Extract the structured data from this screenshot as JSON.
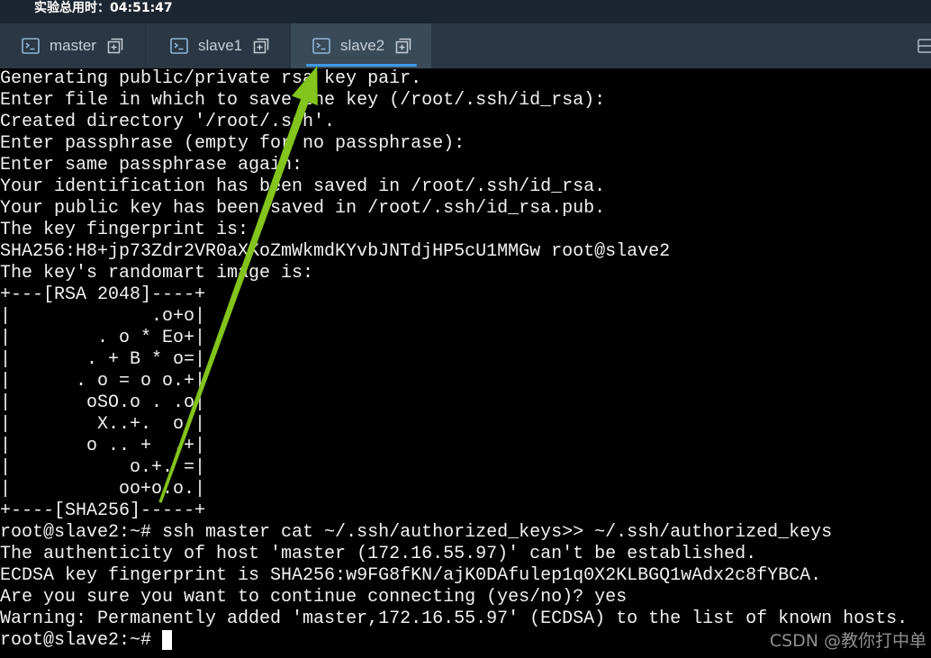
{
  "topbar": {
    "timer": "实验总用时：04:51:47"
  },
  "tabs": [
    {
      "label": "master",
      "icon": "terminal-icon",
      "action_icon": "new-window-icon",
      "active": false
    },
    {
      "label": "slave1",
      "icon": "terminal-icon",
      "action_icon": "new-window-icon",
      "active": false
    },
    {
      "label": "slave2",
      "icon": "terminal-icon",
      "action_icon": "new-window-icon",
      "active": true
    }
  ],
  "tabbar_right_icon": "layout-icon",
  "terminal": {
    "lines": [
      "Generating public/private rsa key pair.",
      "Enter file in which to save the key (/root/.ssh/id_rsa):",
      "Created directory '/root/.ssh'.",
      "Enter passphrase (empty for no passphrase):",
      "Enter same passphrase again:",
      "Your identification has been saved in /root/.ssh/id_rsa.",
      "Your public key has been saved in /root/.ssh/id_rsa.pub.",
      "The key fingerprint is:",
      "SHA256:H8+jp73Zdr2VR0aXKoZmWkmdKYvbJNTdjHP5cU1MMGw root@slave2",
      "The key's randomart image is:",
      "+---[RSA 2048]----+",
      "|             .o+o|",
      "|        . o * Eo+|",
      "|       . + B * o=|",
      "|      . o = o o.+|",
      "|       oSO.o . .o|",
      "|        X..+.  o |",
      "|       o .. +  .+|",
      "|           o.+. =|",
      "|          oo+o.o.|",
      "+----[SHA256]-----+",
      "root@slave2:~# ssh master cat ~/.ssh/authorized_keys>> ~/.ssh/authorized_keys",
      "The authenticity of host 'master (172.16.55.97)' can't be established.",
      "ECDSA key fingerprint is SHA256:w9FG8fKN/ajK0DAfulep1q0X2KLBGQ1wAdx2c8fYBCA.",
      "Are you sure you want to continue connecting (yes/no)? yes",
      "Warning: Permanently added 'master,172.16.55.97' (ECDSA) to the list of known hosts."
    ],
    "prompt": "root@slave2:~# "
  },
  "watermark": "CSDN @教你打中单",
  "colors": {
    "accent": "#3d9be9",
    "tabbar_bg": "#2a3845",
    "tab_active_bg": "#394a59",
    "terminal_bg": "#000000",
    "terminal_fg": "#f2f2f2",
    "annotation_arrow": "#84c51d"
  }
}
